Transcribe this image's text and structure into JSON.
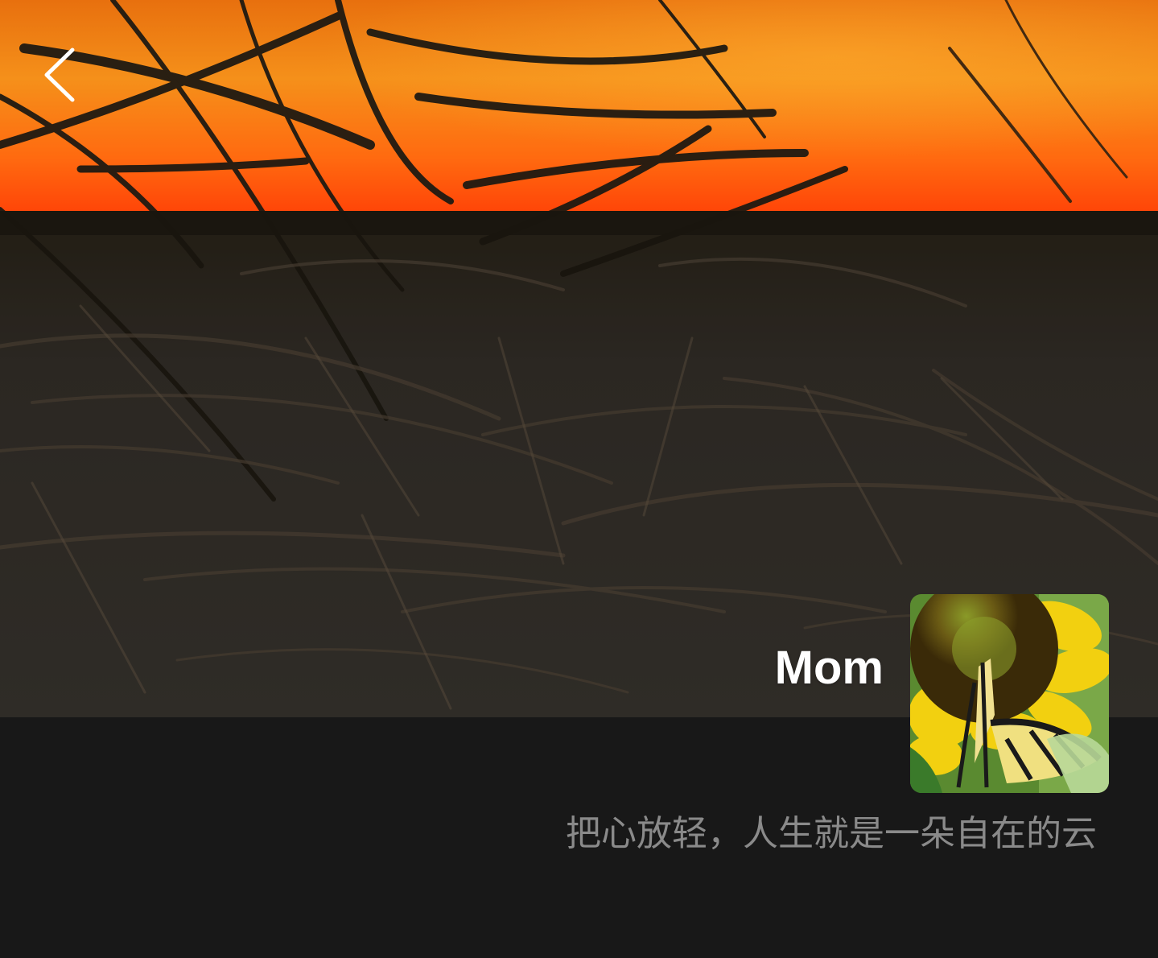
{
  "profile": {
    "nickname": "Mom",
    "signature": "把心放轻，人生就是一朵自在的云"
  },
  "icons": {
    "back": "chevron-left-icon"
  },
  "colors": {
    "background": "#181818",
    "nickname": "#ffffff",
    "signature": "#8a8a8a",
    "sky_top": "#f07a10",
    "sky_horizon": "#ff4a06",
    "field": "#2e2a22"
  }
}
